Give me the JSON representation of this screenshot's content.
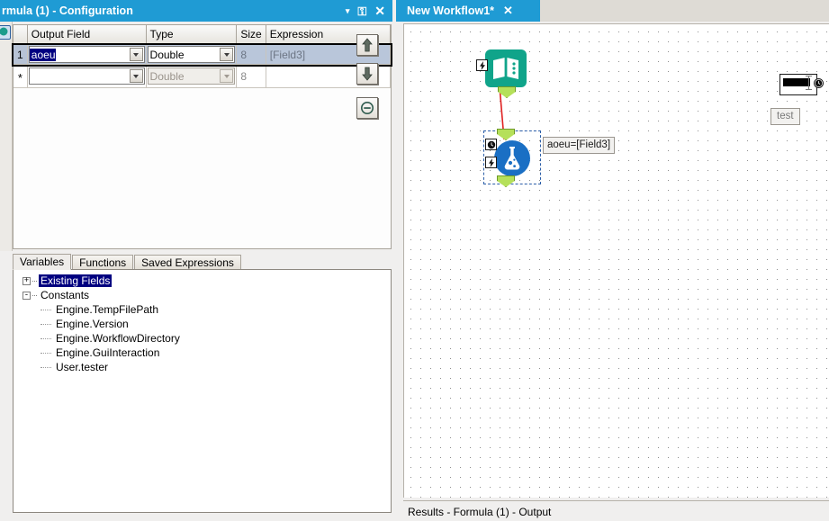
{
  "config_panel": {
    "title": "rmula (1) - Configuration",
    "window_controls": [
      {
        "name": "dropdown-caret",
        "glyph": "▾"
      },
      {
        "name": "pin",
        "glyph": "☰"
      },
      {
        "name": "close",
        "glyph": "✕"
      }
    ],
    "grid": {
      "columns": [
        "Output Field",
        "Type",
        "Size",
        "Expression"
      ],
      "rows": [
        {
          "row_header": "1",
          "output_field": "aoeu",
          "type": "Double",
          "size": "8",
          "expression": "[Field3]",
          "selected": true,
          "new_row": false
        },
        {
          "row_header": "*",
          "output_field": "",
          "type": "Double",
          "size": "8",
          "expression": "",
          "selected": false,
          "new_row": true
        }
      ]
    },
    "side_buttons": [
      {
        "name": "move-up-button",
        "icon": "arrow-up-icon"
      },
      {
        "name": "move-down-button",
        "icon": "arrow-down-icon"
      },
      {
        "name": "delete-row-button",
        "icon": "minus-circle-icon"
      }
    ],
    "tabs": [
      {
        "label": "Variables",
        "active": true
      },
      {
        "label": "Functions",
        "active": false
      },
      {
        "label": "Saved Expressions",
        "active": false
      }
    ],
    "tree": [
      {
        "label": "Existing Fields",
        "expander": "+",
        "selected": true,
        "level": 0
      },
      {
        "label": "Constants",
        "expander": "-",
        "selected": false,
        "level": 0
      },
      {
        "label": "Engine.TempFilePath",
        "expander": "",
        "selected": false,
        "level": 1
      },
      {
        "label": "Engine.Version",
        "expander": "",
        "selected": false,
        "level": 1
      },
      {
        "label": "Engine.WorkflowDirectory",
        "expander": "",
        "selected": false,
        "level": 1
      },
      {
        "label": "Engine.GuiInteraction",
        "expander": "",
        "selected": false,
        "level": 1
      },
      {
        "label": "User.tester",
        "expander": "",
        "selected": false,
        "level": 1
      }
    ]
  },
  "canvas_panel": {
    "tab": {
      "label": "New Workflow1*",
      "close_glyph": "✕"
    },
    "nodes": [
      {
        "name": "input-data-node",
        "icon": "book-icon",
        "badge": "lightning-icon"
      },
      {
        "name": "formula-node",
        "icon": "flask-icon",
        "badges": [
          "clock-icon",
          "lightning-icon"
        ],
        "selected": true
      }
    ],
    "annotation": "aoeu=[Field3]",
    "comment_box": "test",
    "text_tool": {
      "name": "text-tool-icon",
      "badge": "clock-icon"
    },
    "connection": {
      "name": "connector-line",
      "color": "#e02020"
    }
  },
  "results_bar": {
    "label": "Results - Formula (1) - Output"
  },
  "colors": {
    "accent_blue": "#1f9bd4",
    "selection_navy": "#000080",
    "row_selection": "#b9c6da",
    "node_teal": "#10a48a",
    "node_blue": "#1a6fc4",
    "anchor_green": "#b5e05a",
    "connector_red": "#e02020"
  }
}
